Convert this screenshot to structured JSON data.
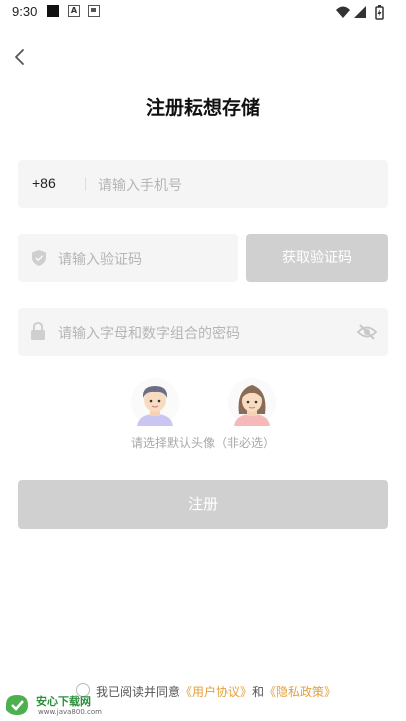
{
  "status_bar": {
    "time": "9:30",
    "icons": [
      "notification-square-icon",
      "a-app-icon",
      "sim-card-icon",
      "wifi-icon",
      "signal-icon",
      "battery-charging-icon"
    ]
  },
  "header": {
    "back_icon": "chevron-left-icon",
    "title": "注册耘想存储"
  },
  "form": {
    "country_code": "+86",
    "phone_placeholder": "请输入手机号",
    "code_placeholder": "请输入验证码",
    "get_code_label": "获取验证码",
    "password_placeholder": "请输入字母和数字组合的密码"
  },
  "avatars": {
    "options": [
      "male-avatar",
      "female-avatar"
    ],
    "hint": "请选择默认头像（非必选）"
  },
  "register_label": "注册",
  "agreement": {
    "prefix": "我已阅读并同意",
    "user_agreement": "《用户协议》",
    "conjunction": "和",
    "privacy_policy": "《隐私政策》"
  },
  "watermark": {
    "name": "安心下载网",
    "url": "www.java800.com"
  },
  "colors": {
    "disabled_button": "#d0d0d0",
    "input_background": "#f5f5f5",
    "link": "#e0a040",
    "placeholder": "#b5b5b5"
  }
}
